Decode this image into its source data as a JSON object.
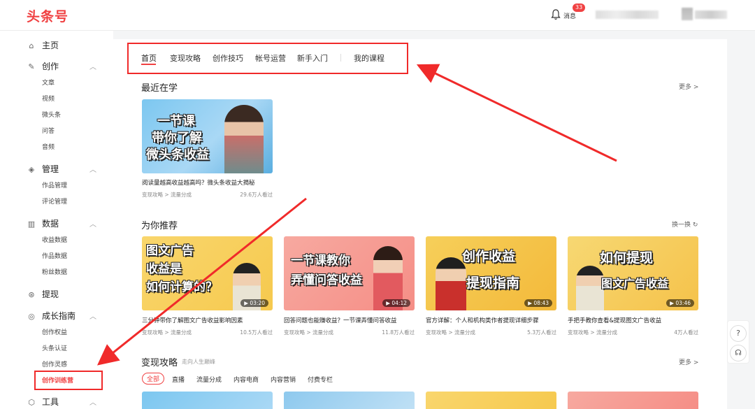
{
  "header": {
    "logo": "头条号",
    "msg_label": "消息",
    "msg_count": "33"
  },
  "sidebar": {
    "home": "主页",
    "create": "创作",
    "create_items": [
      "文章",
      "视频",
      "微头条",
      "问答",
      "音频"
    ],
    "manage": "管理",
    "manage_items": [
      "作品管理",
      "评论管理"
    ],
    "data": "数据",
    "data_items": [
      "收益数据",
      "作品数据",
      "粉丝数据"
    ],
    "withdraw": "提现",
    "growth": "成长指南",
    "growth_items": [
      "创作权益",
      "头条认证",
      "创作灵感",
      "创作训练营"
    ],
    "tools": "工具"
  },
  "tabs": [
    "首页",
    "变现攻略",
    "创作技巧",
    "帐号运营",
    "新手入门",
    "我的课程"
  ],
  "recent": {
    "title": "最近在学",
    "more": "更多 >",
    "card": {
      "thumb_text": [
        "一节课",
        "带你了解",
        "微头条收益"
      ],
      "title": "阅读量越高收益越高吗？微头条收益大揭秘",
      "meta": "变现攻略 > 流量分成",
      "views": "29.6万人看过"
    }
  },
  "recommend": {
    "title": "为你推荐",
    "refresh": "换一换",
    "cards": [
      {
        "thumb_text": [
          "图文广告",
          "收益是",
          "如何计算的？"
        ],
        "duration": "03:20",
        "title": "三分钟带你了解图文广告收益影响因素",
        "meta": "变现攻略 > 流量分成",
        "views": "10.5万人看过"
      },
      {
        "thumb_text": [
          "一节课教你",
          "弄懂问答收益"
        ],
        "duration": "04:12",
        "title": "回答问题也能赚收益？一节课弄懂问答收益",
        "meta": "变现攻略 > 流量分成",
        "views": "11.8万人看过"
      },
      {
        "thumb_text": [
          "创作收益",
          "提现指南"
        ],
        "duration": "08:43",
        "title": "官方详解：个人和机构类作者提现详细步骤",
        "meta": "变现攻略 > 流量分成",
        "views": "5.3万人看过"
      },
      {
        "thumb_text": [
          "如何提现",
          "图文广告收益"
        ],
        "duration": "03:46",
        "title": "手把手教你查看&提现图文广告收益",
        "meta": "变现攻略 > 流量分成",
        "views": "4万人看过"
      }
    ]
  },
  "monetize": {
    "title": "变现攻略",
    "subtitle": "走向人生巅峰",
    "more": "更多 >",
    "filters": [
      "全部",
      "直播",
      "流量分成",
      "内容电商",
      "内容营销",
      "付费专栏"
    ]
  },
  "colors": {
    "brand": "#f04142",
    "annotation": "#f02a2a"
  },
  "icons": [
    "home-icon",
    "pen-icon",
    "layers-icon",
    "chart-icon",
    "coin-icon",
    "compass-icon",
    "box-icon",
    "bell-icon",
    "help-icon",
    "headset-icon"
  ]
}
